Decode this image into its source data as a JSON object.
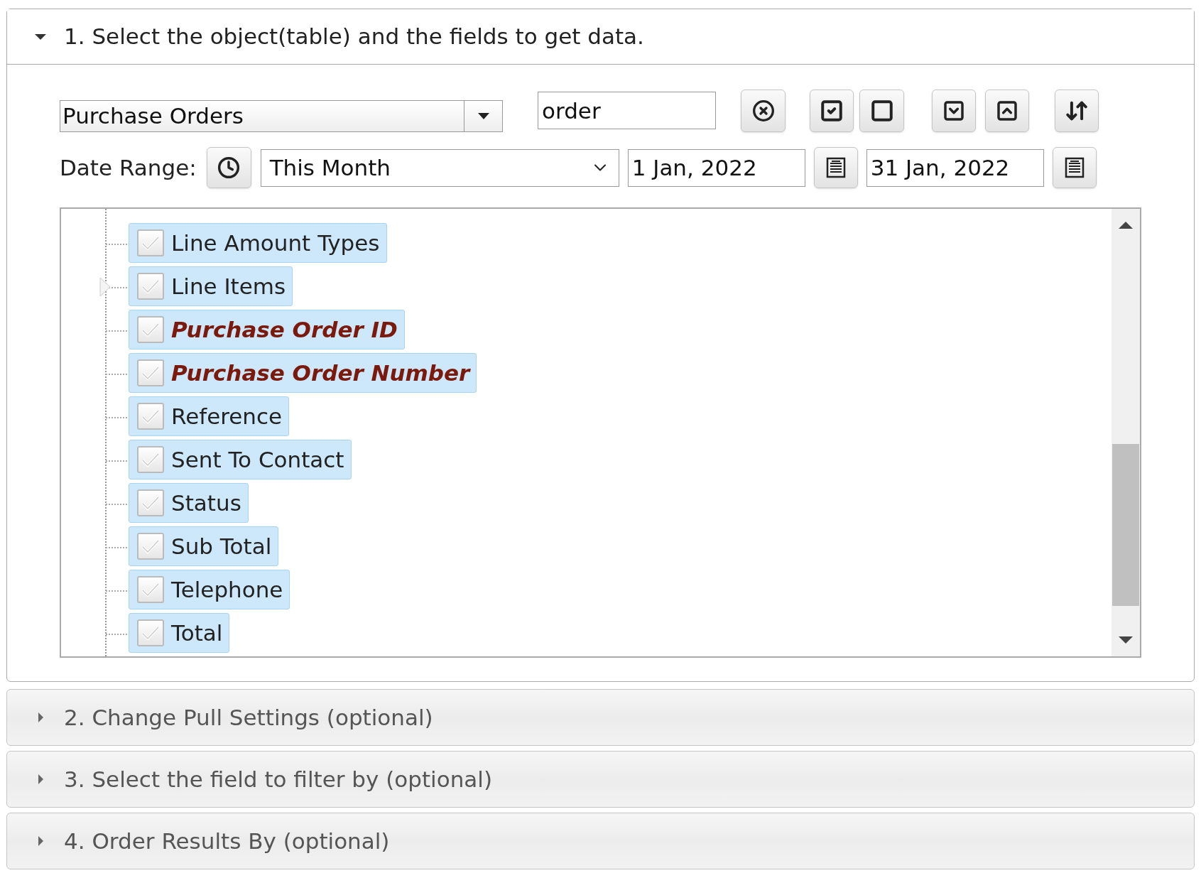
{
  "sections": [
    {
      "title": "1. Select the object(table) and the fields to get data.",
      "expanded": true
    },
    {
      "title": "2. Change Pull Settings (optional)",
      "expanded": false
    },
    {
      "title": "3. Select the field to filter by (optional)",
      "expanded": false
    },
    {
      "title": "4. Order Results By (optional)",
      "expanded": false
    }
  ],
  "object_select": {
    "value": "Purchase Orders"
  },
  "search": {
    "value": "order"
  },
  "date_range": {
    "label": "Date Range:",
    "preset": "This Month",
    "from": "1 Jan, 2022",
    "to": "31 Jan, 2022"
  },
  "tree": {
    "items": [
      {
        "label": "Line Amount Types",
        "kind": "field",
        "checked": true,
        "highlighted": false
      },
      {
        "label": "Line Items",
        "kind": "group",
        "expanded": false,
        "checked": true,
        "highlighted": false
      },
      {
        "label": "Purchase Order ID",
        "kind": "field",
        "checked": true,
        "highlighted": true
      },
      {
        "label": "Purchase Order Number",
        "kind": "field",
        "checked": true,
        "highlighted": true
      },
      {
        "label": "Reference",
        "kind": "field",
        "checked": true,
        "highlighted": false
      },
      {
        "label": "Sent To Contact",
        "kind": "field",
        "checked": true,
        "highlighted": false
      },
      {
        "label": "Status",
        "kind": "field",
        "checked": true,
        "highlighted": false
      },
      {
        "label": "Sub Total",
        "kind": "field",
        "checked": true,
        "highlighted": false
      },
      {
        "label": "Telephone",
        "kind": "field",
        "checked": true,
        "highlighted": false
      },
      {
        "label": "Total",
        "kind": "field",
        "checked": true,
        "highlighted": false
      }
    ]
  }
}
